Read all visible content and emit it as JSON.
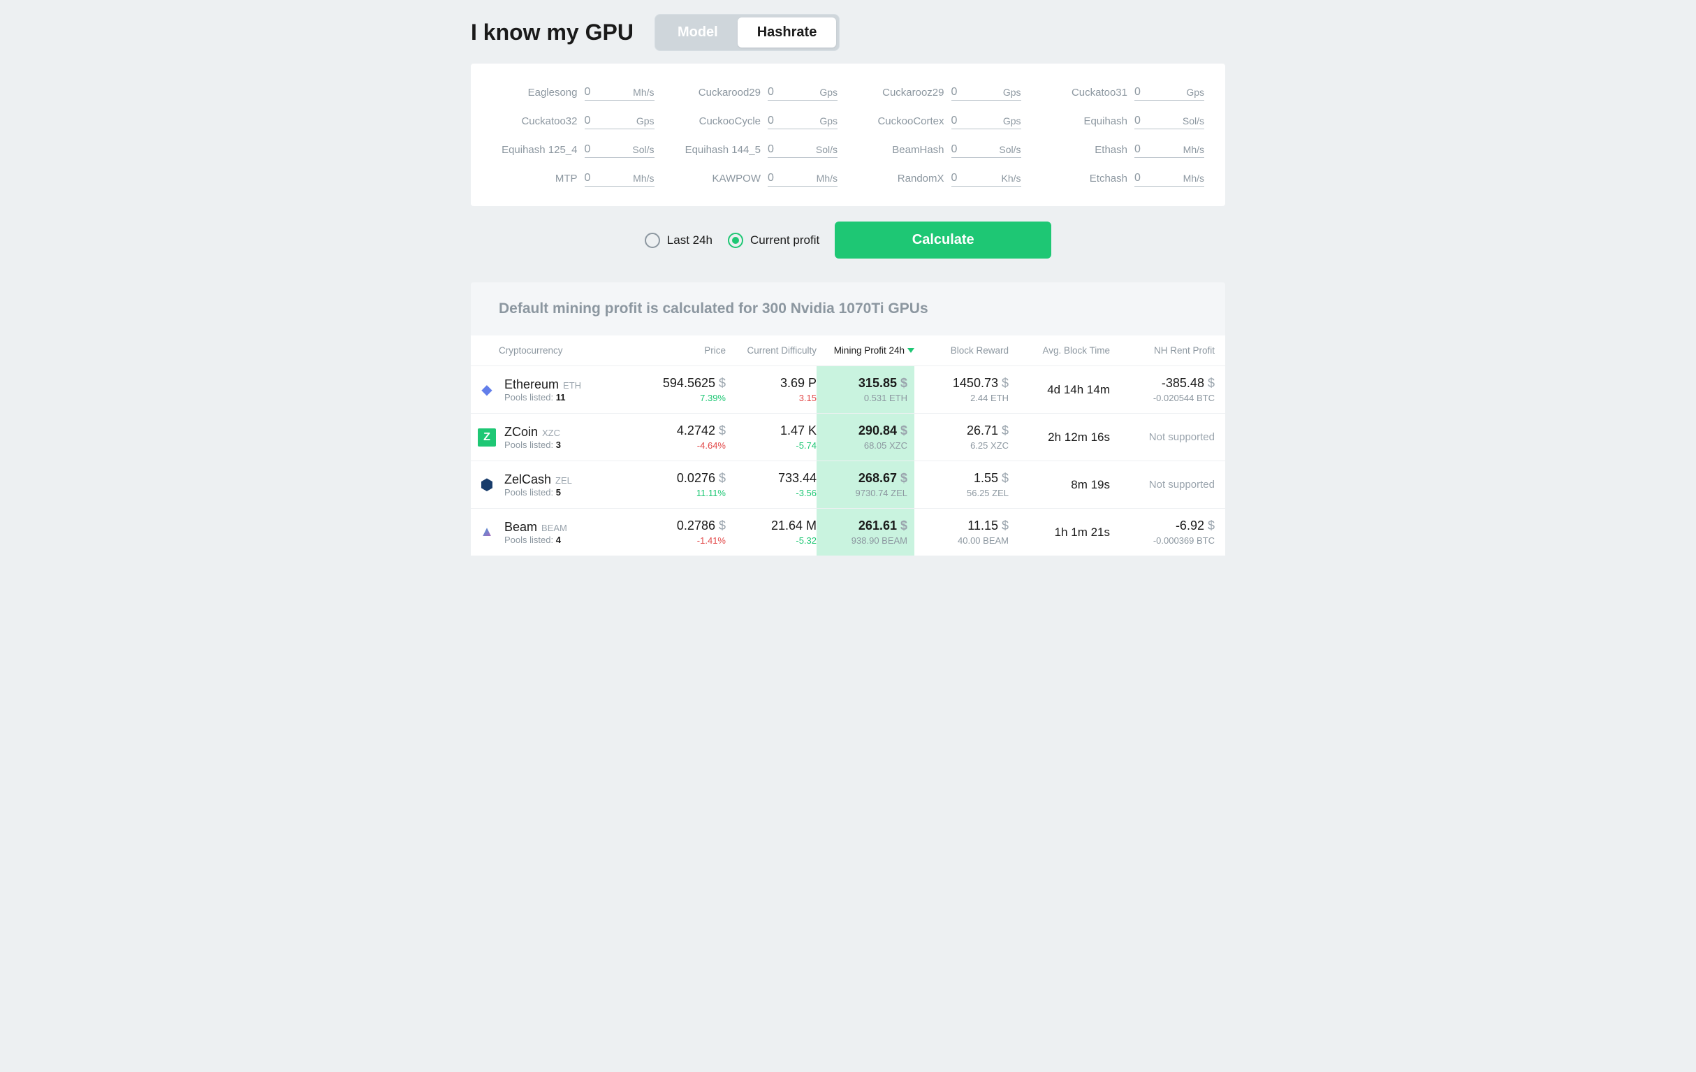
{
  "heading": "I know my GPU",
  "toggle": {
    "model": "Model",
    "hashrate": "Hashrate"
  },
  "hash_inputs": [
    {
      "label": "Eaglesong",
      "value": "0",
      "unit": "Mh/s"
    },
    {
      "label": "Cuckarood29",
      "value": "0",
      "unit": "Gps"
    },
    {
      "label": "Cuckarooz29",
      "value": "0",
      "unit": "Gps"
    },
    {
      "label": "Cuckatoo31",
      "value": "0",
      "unit": "Gps"
    },
    {
      "label": "Cuckatoo32",
      "value": "0",
      "unit": "Gps"
    },
    {
      "label": "CuckooCycle",
      "value": "0",
      "unit": "Gps"
    },
    {
      "label": "CuckooCortex",
      "value": "0",
      "unit": "Gps"
    },
    {
      "label": "Equihash",
      "value": "0",
      "unit": "Sol/s"
    },
    {
      "label": "Equihash 125_4",
      "value": "0",
      "unit": "Sol/s"
    },
    {
      "label": "Equihash 144_5",
      "value": "0",
      "unit": "Sol/s"
    },
    {
      "label": "BeamHash",
      "value": "0",
      "unit": "Sol/s"
    },
    {
      "label": "Ethash",
      "value": "0",
      "unit": "Mh/s"
    },
    {
      "label": "MTP",
      "value": "0",
      "unit": "Mh/s"
    },
    {
      "label": "KAWPOW",
      "value": "0",
      "unit": "Mh/s"
    },
    {
      "label": "RandomX",
      "value": "0",
      "unit": "Kh/s"
    },
    {
      "label": "Etchash",
      "value": "0",
      "unit": "Mh/s"
    }
  ],
  "radios": {
    "last24h": "Last 24h",
    "current": "Current profit"
  },
  "calculate": "Calculate",
  "info_bar": "Default mining profit is calculated for 300 Nvidia 1070Ti GPUs",
  "columns": {
    "crypto": "Cryptocurrency",
    "price": "Price",
    "difficulty": "Current Difficulty",
    "profit": "Mining Profit 24h",
    "reward": "Block Reward",
    "blocktime": "Avg. Block Time",
    "nh": "NH Rent Profit"
  },
  "pools_label": "Pools listed:",
  "not_supported": "Not supported",
  "rows": [
    {
      "name": "Ethereum",
      "sym": "ETH",
      "pools": "11",
      "price": "594.5625",
      "price_change": "7.39%",
      "price_dir": "green",
      "diff": "3.69 P",
      "diff_change": "3.15",
      "diff_dir": "red",
      "profit_usd": "315.85",
      "profit_coin": "0.531 ETH",
      "reward_usd": "1450.73",
      "reward_coin": "2.44 ETH",
      "blocktime": "4d 14h 14m",
      "nh_usd": "-385.48",
      "nh_btc": "-0.020544 BTC",
      "nh_supported": true,
      "icon": "eth"
    },
    {
      "name": "ZCoin",
      "sym": "XZC",
      "pools": "3",
      "price": "4.2742",
      "price_change": "-4.64%",
      "price_dir": "red",
      "diff": "1.47 K",
      "diff_change": "-5.74",
      "diff_dir": "green",
      "profit_usd": "290.84",
      "profit_coin": "68.05 XZC",
      "reward_usd": "26.71",
      "reward_coin": "6.25 XZC",
      "blocktime": "2h 12m 16s",
      "nh_supported": false,
      "icon": "zcoin"
    },
    {
      "name": "ZelCash",
      "sym": "ZEL",
      "pools": "5",
      "price": "0.0276",
      "price_change": "11.11%",
      "price_dir": "green",
      "diff": "733.44",
      "diff_change": "-3.56",
      "diff_dir": "green",
      "profit_usd": "268.67",
      "profit_coin": "9730.74 ZEL",
      "reward_usd": "1.55",
      "reward_coin": "56.25 ZEL",
      "blocktime": "8m 19s",
      "nh_supported": false,
      "icon": "zel"
    },
    {
      "name": "Beam",
      "sym": "BEAM",
      "pools": "4",
      "price": "0.2786",
      "price_change": "-1.41%",
      "price_dir": "red",
      "diff": "21.64 M",
      "diff_change": "-5.32",
      "diff_dir": "green",
      "profit_usd": "261.61",
      "profit_coin": "938.90 BEAM",
      "reward_usd": "11.15",
      "reward_coin": "40.00 BEAM",
      "blocktime": "1h 1m 21s",
      "nh_usd": "-6.92",
      "nh_btc": "-0.000369 BTC",
      "nh_supported": true,
      "icon": "beam"
    }
  ]
}
